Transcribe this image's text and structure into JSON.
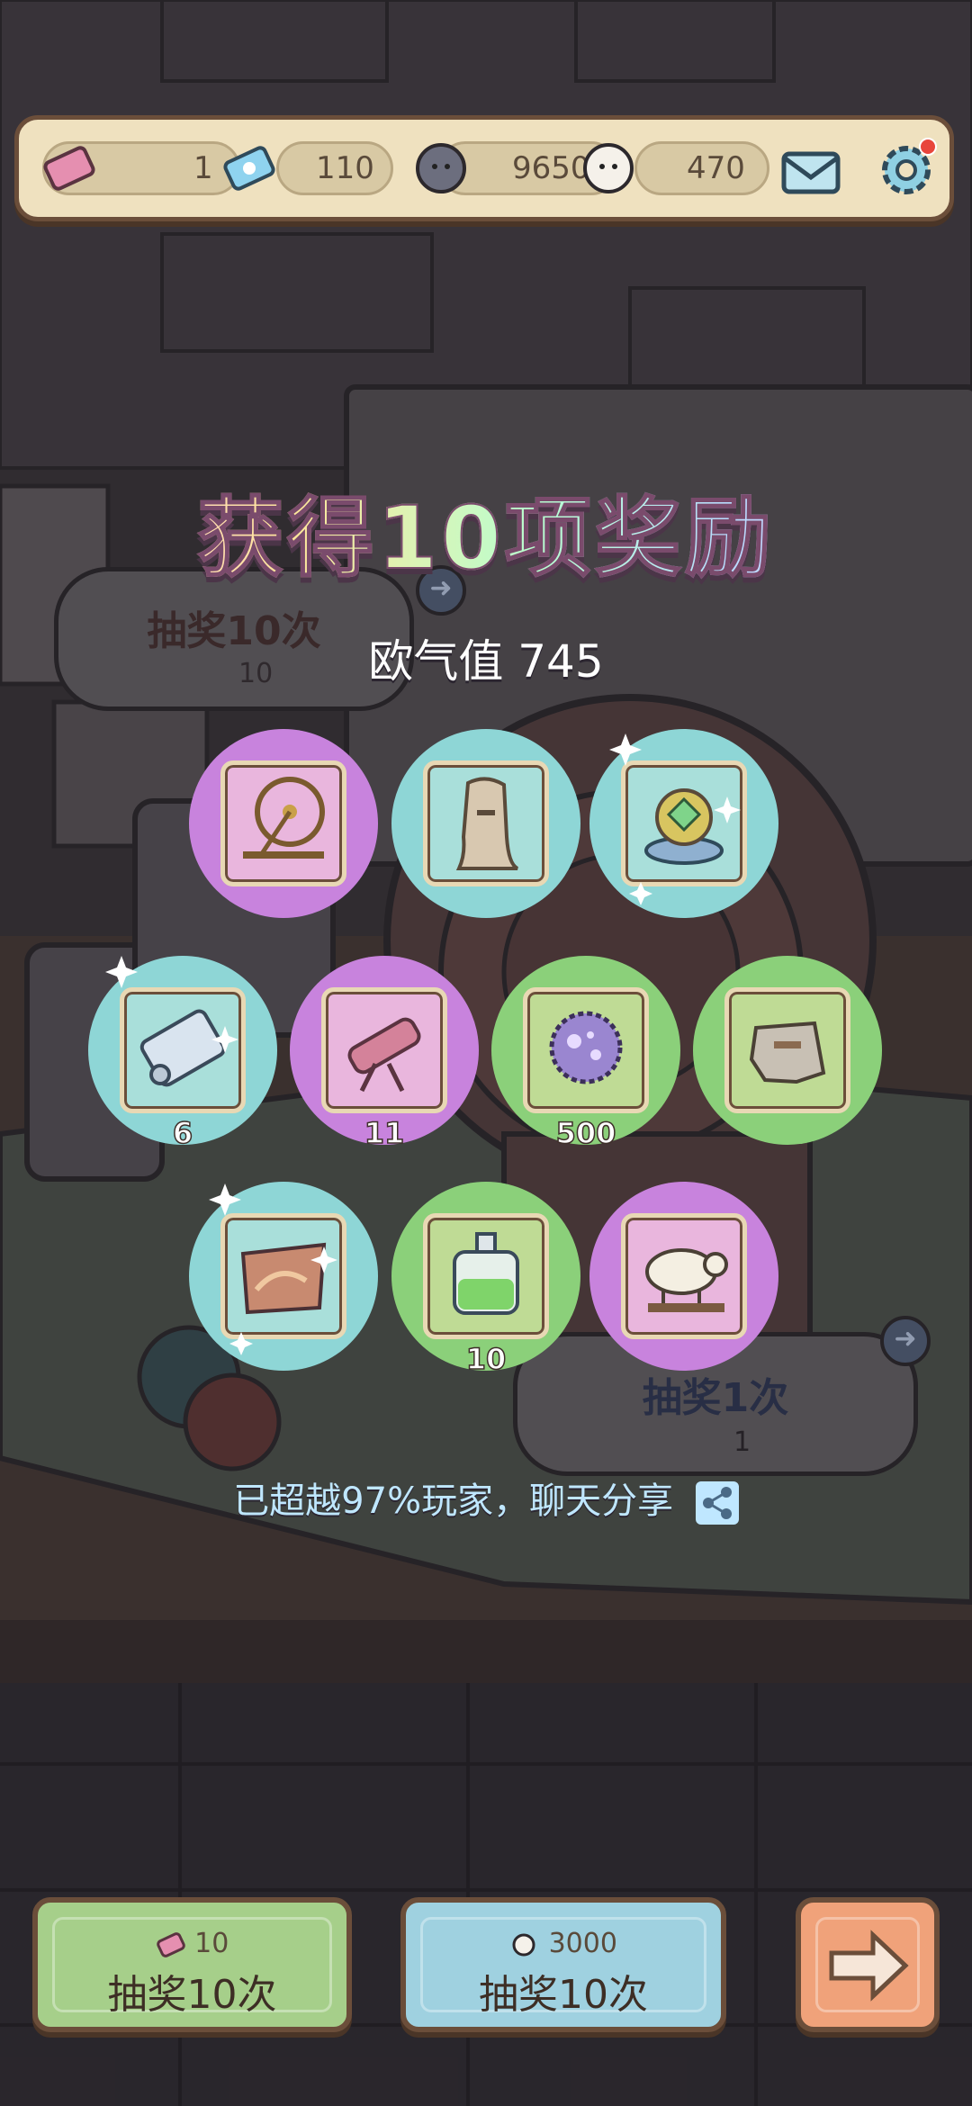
{
  "resources": {
    "ticket": "1",
    "gem": "110",
    "dark_bubble": "9650",
    "light_bubble": "470"
  },
  "title": "获得10项奖励",
  "luck_label": "欧气值 745",
  "background_board_top": {
    "label": "抽奖10次",
    "cost": "10"
  },
  "background_board_bottom": {
    "label": "抽奖1次",
    "cost": "1"
  },
  "rewards": [
    {
      "icon": "spinning-wheel-icon",
      "color": "purple",
      "qty": ""
    },
    {
      "icon": "moai-statue-icon",
      "color": "teal",
      "qty": ""
    },
    {
      "icon": "globe-artifact-icon",
      "color": "teal",
      "qty": ""
    },
    {
      "icon": "scroll-icon",
      "color": "teal",
      "qty": "6"
    },
    {
      "icon": "telescope-icon",
      "color": "purple",
      "qty": "11"
    },
    {
      "icon": "virus-cell-icon",
      "color": "green",
      "qty": "500"
    },
    {
      "icon": "stone-fragment-icon",
      "color": "green",
      "qty": ""
    },
    {
      "icon": "painting-icon",
      "color": "teal",
      "qty": ""
    },
    {
      "icon": "potion-bottle-icon",
      "color": "green",
      "qty": "10"
    },
    {
      "icon": "sheep-figure-icon",
      "color": "purple",
      "qty": ""
    }
  ],
  "share_text": "已超越97%玩家，聊天分享",
  "buttons": {
    "draw10_ticket": {
      "cost": "10",
      "label": "抽奖10次"
    },
    "draw10_bubble": {
      "cost": "3000",
      "label": "抽奖10次"
    }
  },
  "colors": {
    "purple": "#c883dd",
    "teal": "#8ed6d6",
    "green": "#8bd07a",
    "button_green": "#a6cf8a",
    "button_blue": "#9fd1e0",
    "button_orange": "#f0a27a"
  }
}
